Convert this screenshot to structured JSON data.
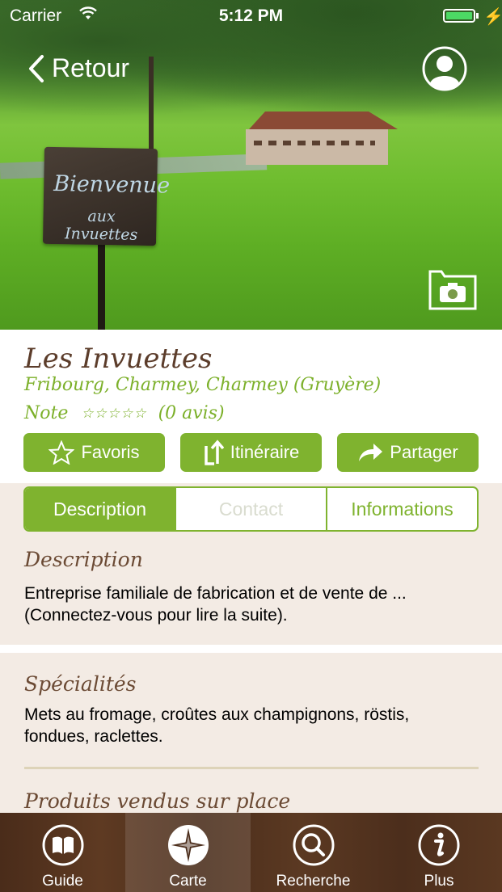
{
  "status_bar": {
    "carrier": "Carrier",
    "time": "5:12 PM"
  },
  "hero": {
    "sign_line1": "Bienvenue",
    "sign_line2": "aux Invuettes",
    "back_label": "Retour"
  },
  "place": {
    "name": "Les Invuettes",
    "location": "Fribourg, Charmey, Charmey (Gruyère)",
    "note_label": "Note",
    "stars": "☆☆☆☆☆",
    "reviews": "(0 avis)"
  },
  "actions": {
    "favoris": "Favoris",
    "itineraire": "Itinéraire",
    "partager": "Partager"
  },
  "tabs": [
    {
      "label": "Description"
    },
    {
      "label": "Contact"
    },
    {
      "label": "Informations"
    }
  ],
  "description": {
    "title": "Description",
    "text": "Entreprise familiale de fabrication et de vente de ... (Connectez-vous pour lire la suite)."
  },
  "specialites": {
    "title": "Spécialités",
    "text": "Mets au fromage, croûtes aux champignons, röstis, fondues, raclettes."
  },
  "produits": {
    "title": "Produits vendus sur place"
  },
  "tab_bar": [
    {
      "label": "Guide",
      "icon": "book-icon"
    },
    {
      "label": "Carte",
      "icon": "compass-icon"
    },
    {
      "label": "Recherche",
      "icon": "search-icon"
    },
    {
      "label": "Plus",
      "icon": "info-icon"
    }
  ],
  "colors": {
    "accent": "#7fb32f",
    "title_brown": "#5c3d2b",
    "wood": "#4f301d",
    "battery": "#4cd964"
  }
}
